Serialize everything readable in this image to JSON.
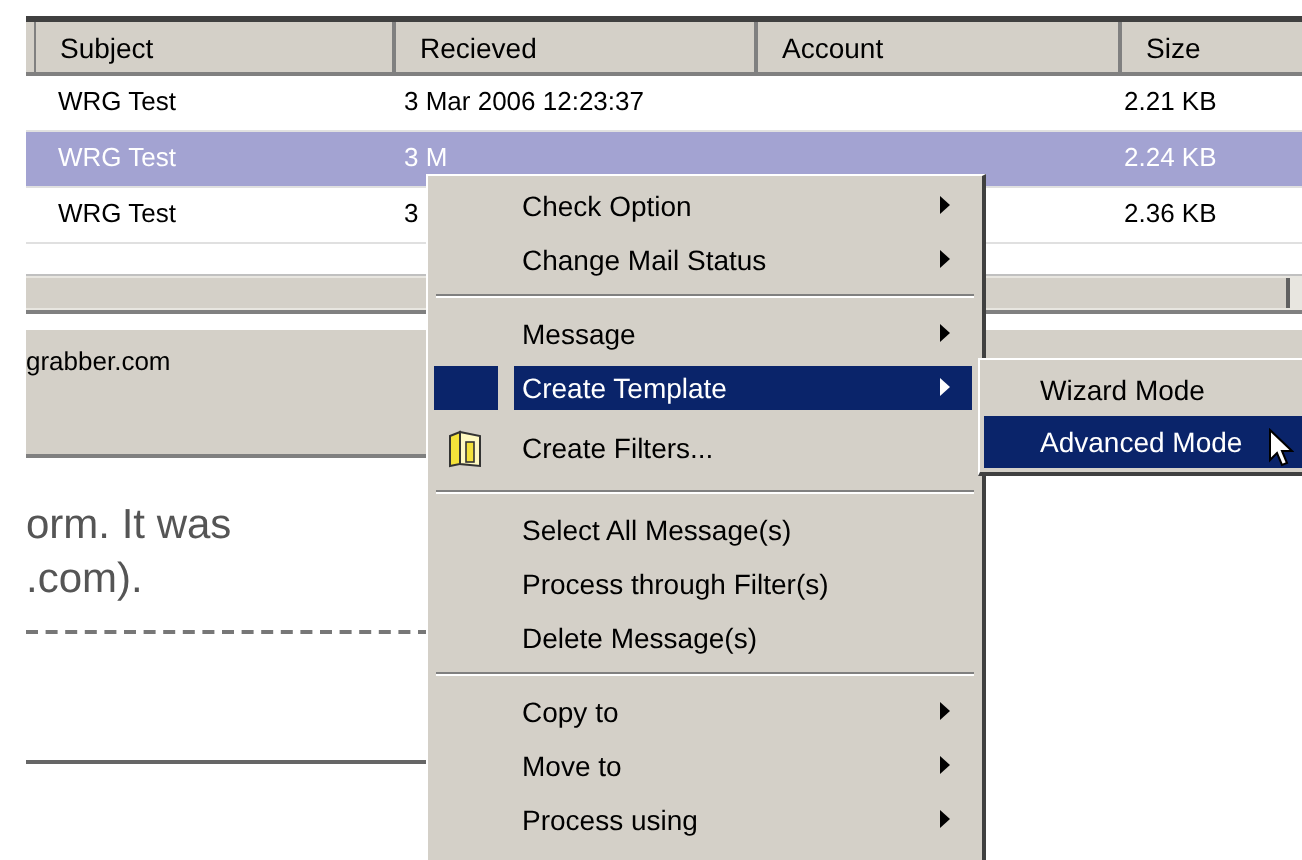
{
  "table": {
    "columns": [
      "Subject",
      "Recieved",
      "Account",
      "Size"
    ],
    "rows": [
      {
        "subject": "WRG Test",
        "received": "3 Mar 2006 12:23:37",
        "account": "",
        "size": "2.21 KB",
        "selected": false
      },
      {
        "subject": "WRG Test",
        "received": "3 M",
        "account": "",
        "size": "2.24 KB",
        "selected": true
      },
      {
        "subject": "WRG Test",
        "received": "3",
        "account": "",
        "size": "2.36 KB",
        "selected": false
      }
    ]
  },
  "info_panel": {
    "text": "grabber.com"
  },
  "preview": {
    "lines": [
      "orm.  It was",
      ".com)."
    ]
  },
  "context_menu": {
    "items": [
      {
        "kind": "item",
        "label": "Check Option",
        "submenu": true,
        "selected": false
      },
      {
        "kind": "item",
        "label": "Change Mail Status",
        "submenu": true,
        "selected": false
      },
      {
        "kind": "separator"
      },
      {
        "kind": "item",
        "label": "Message",
        "submenu": true,
        "selected": false
      },
      {
        "kind": "item",
        "label": "Create Template",
        "submenu": true,
        "selected": true
      },
      {
        "kind": "icon-item",
        "label": "Create Filters...",
        "submenu": false,
        "selected": false
      },
      {
        "kind": "separator"
      },
      {
        "kind": "item",
        "label": "Select All Message(s)",
        "submenu": false,
        "selected": false
      },
      {
        "kind": "item",
        "label": "Process through Filter(s)",
        "submenu": false,
        "selected": false
      },
      {
        "kind": "item",
        "label": "Delete Message(s)",
        "submenu": false,
        "selected": false
      },
      {
        "kind": "separator"
      },
      {
        "kind": "item",
        "label": "Copy to",
        "submenu": true,
        "selected": false
      },
      {
        "kind": "item",
        "label": "Move to",
        "submenu": true,
        "selected": false
      },
      {
        "kind": "item",
        "label": "Process using",
        "submenu": true,
        "selected": false
      }
    ]
  },
  "submenu": {
    "items": [
      {
        "label": "Wizard Mode",
        "selected": false
      },
      {
        "label": "Advanced Mode",
        "selected": true
      }
    ]
  }
}
